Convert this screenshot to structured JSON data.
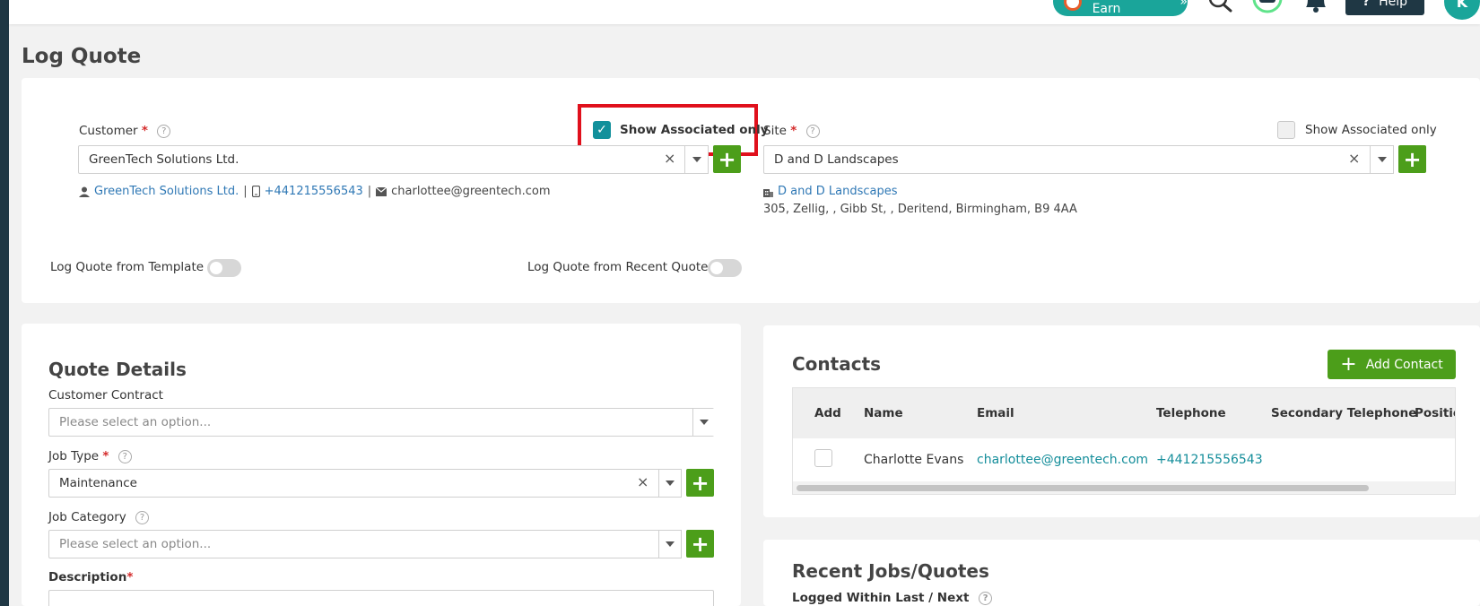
{
  "header": {
    "refer_label": "Refer & Earn",
    "refer_chevrons": "»",
    "help_label": "Help",
    "avatar_initial": "K"
  },
  "page": {
    "title": "Log Quote"
  },
  "customer": {
    "label": "Customer",
    "required_mark": "*",
    "help_icon": "?",
    "show_associated_label": "Show Associated only",
    "show_associated_checked": true,
    "value": "GreenTech Solutions Ltd.",
    "clear_glyph": "×",
    "info_name": "GreenTech Solutions Ltd.",
    "info_separator": "|",
    "info_phone": "+441215556543",
    "info_email": "charlottee@greentech.com"
  },
  "site": {
    "label": "Site",
    "required_mark": "*",
    "help_icon": "?",
    "show_associated_label": "Show Associated only",
    "show_associated_checked": false,
    "value": "D and D Landscapes",
    "clear_glyph": "×",
    "info_name": "D and D Landscapes",
    "info_address": "305, Zellig, , Gibb St, , Deritend, Birmingham, B9 4AA"
  },
  "toggles": {
    "from_template": "Log Quote from Template",
    "from_recent": "Log Quote from Recent Quote"
  },
  "quote_details": {
    "title": "Quote Details",
    "contract_label": "Customer Contract",
    "contract_placeholder": "Please select an option...",
    "job_type_label": "Job Type",
    "job_type_required": "*",
    "job_type_value": "Maintenance",
    "job_category_label": "Job Category",
    "job_category_placeholder": "Please select an option...",
    "description_label": "Description",
    "description_required": "*",
    "help_icon": "?",
    "clear_glyph": "×"
  },
  "contacts": {
    "title": "Contacts",
    "add_button": "Add Contact",
    "columns": [
      "Add",
      "Name",
      "Email",
      "Telephone",
      "Secondary Telephone",
      "Positio"
    ],
    "rows": [
      {
        "name": "Charlotte Evans",
        "email": "charlottee@greentech.com",
        "telephone": "+441215556543"
      }
    ]
  },
  "recent": {
    "title": "Recent Jobs/Quotes",
    "logged_label": "Logged Within Last / Next",
    "help_icon": "?"
  },
  "colors": {
    "primary_green": "#4c9e1a",
    "teal": "#138d9a",
    "highlight_red": "#e0101c"
  }
}
